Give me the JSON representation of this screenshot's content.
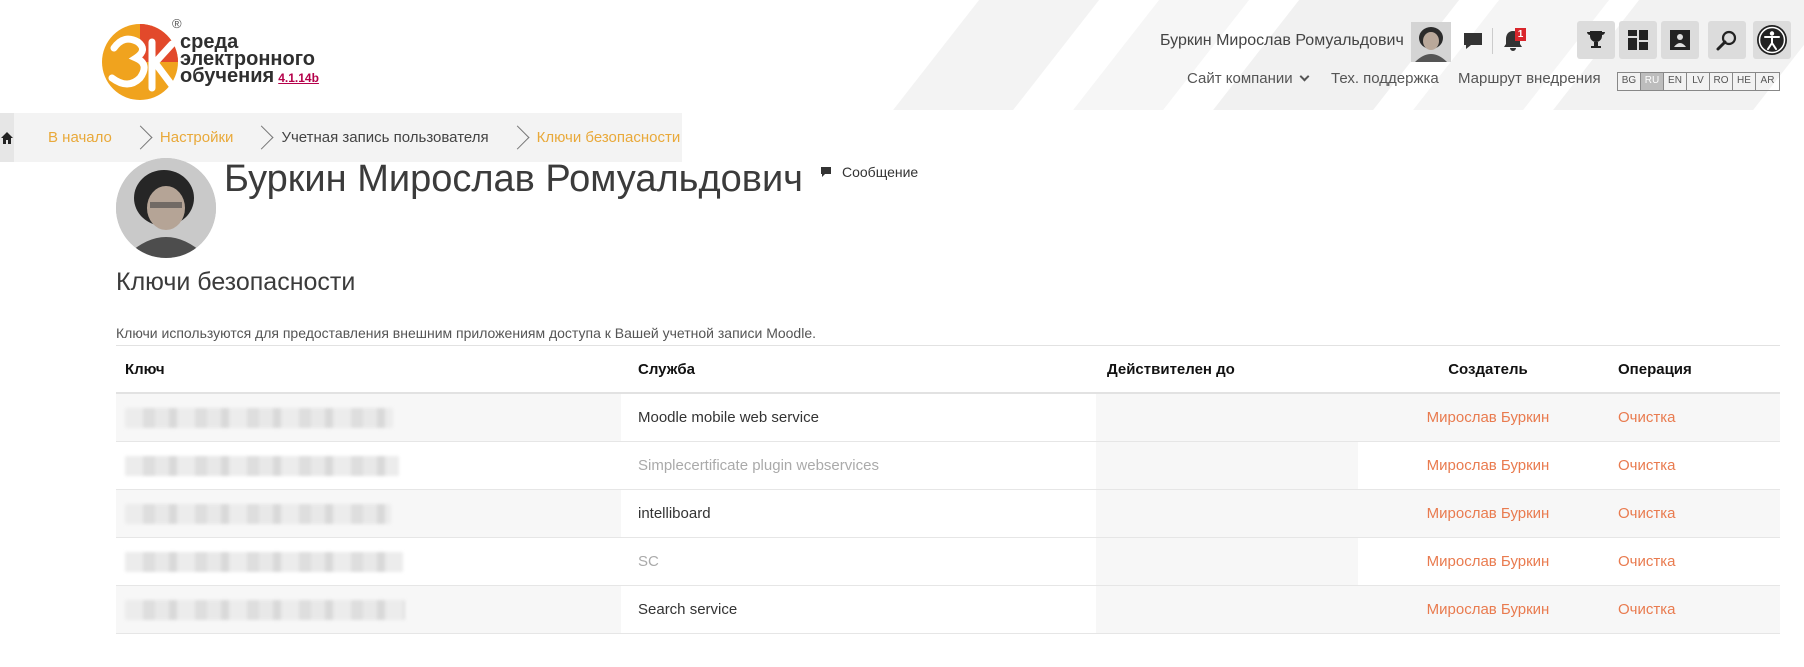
{
  "brand": {
    "logo_mark": "3k",
    "line1": "среда",
    "line2": "электронного",
    "line3": "обучения",
    "version": "4.1.14b",
    "registered": "®"
  },
  "header": {
    "user_name": "Буркин Мирослав Ромуальдович",
    "notification_count": "1",
    "nav": {
      "company": "Сайт компании",
      "support": "Тех. поддержка",
      "route": "Маршрут внедрения"
    },
    "languages": [
      "BG",
      "RU",
      "EN",
      "LV",
      "RO",
      "HE",
      "AR"
    ],
    "active_language": "RU",
    "tools": [
      "trophy-icon",
      "dashboard-icon",
      "course-icon",
      "search-icon"
    ]
  },
  "breadcrumb": {
    "items": [
      "В начало",
      "Настройки",
      "Учетная запись пользователя",
      "Ключи безопасности"
    ]
  },
  "profile": {
    "name": "Буркин Мирослав Ромуальдович",
    "message_label": "Сообщение"
  },
  "page": {
    "title": "Ключи безопасности",
    "intro": "Ключи используются для предоставления внешним приложениям доступа к Вашей учетной записи Moodle."
  },
  "table": {
    "headers": {
      "key": "Ключ",
      "service": "Служба",
      "valid_until": "Действителен до",
      "creator": "Создатель",
      "operation": "Операция"
    },
    "rows": [
      {
        "service": "Moodle mobile web service",
        "enabled": true,
        "valid_until": "",
        "creator": "Мирослав Буркин",
        "operation": "Очистка"
      },
      {
        "service": "Simplecertificate plugin webservices",
        "enabled": false,
        "valid_until": "",
        "creator": "Мирослав Буркин",
        "operation": "Очистка"
      },
      {
        "service": "intelliboard",
        "enabled": true,
        "valid_until": "",
        "creator": "Мирослав Буркин",
        "operation": "Очистка"
      },
      {
        "service": "SC",
        "enabled": false,
        "valid_until": "",
        "creator": "Мирослав Буркин",
        "operation": "Очистка"
      },
      {
        "service": "Search service",
        "enabled": true,
        "valid_until": "",
        "creator": "Мирослав Буркин",
        "operation": "Очистка"
      }
    ]
  },
  "colors": {
    "link_accent": "#e97b4f",
    "breadcrumb_link": "#e9a93a",
    "logo_orange": "#f0a31e",
    "logo_red": "#e2492b"
  }
}
